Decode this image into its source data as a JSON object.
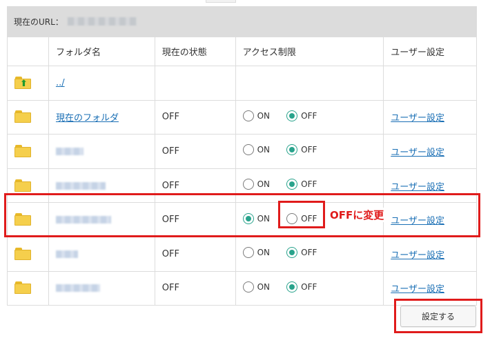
{
  "url_bar": {
    "label": "現在のURL："
  },
  "table": {
    "headers": [
      "",
      "フォルダ名",
      "現在の状態",
      "アクセス制限",
      "ユーザー設定"
    ],
    "parent_link": "../",
    "on_label": "ON",
    "off_label": "OFF",
    "rows": [
      {
        "name": "現在のフォルダ",
        "name_blurred": false,
        "status": "OFF",
        "access": "OFF",
        "user_settings": "ユーザー設定"
      },
      {
        "name": "",
        "name_blurred": true,
        "status": "OFF",
        "access": "OFF",
        "user_settings": "ユーザー設定"
      },
      {
        "name": "",
        "name_blurred": true,
        "status": "OFF",
        "access": "OFF",
        "user_settings": "ユーザー設定"
      },
      {
        "name": "",
        "name_blurred": true,
        "status": "OFF",
        "access": "ON",
        "user_settings": "ユーザー設定"
      },
      {
        "name": "",
        "name_blurred": true,
        "status": "OFF",
        "access": "OFF",
        "user_settings": "ユーザー設定"
      },
      {
        "name": "",
        "name_blurred": true,
        "status": "OFF",
        "access": "OFF",
        "user_settings": "ユーザー設定"
      }
    ]
  },
  "annotation": {
    "text": "OFFに変更",
    "color": "#e01b1b"
  },
  "submit_button": {
    "label": "設定する"
  },
  "colors": {
    "radio_checked": "#29a38c",
    "link": "#1a6fb5",
    "header_bar": "#dcdcdc"
  }
}
